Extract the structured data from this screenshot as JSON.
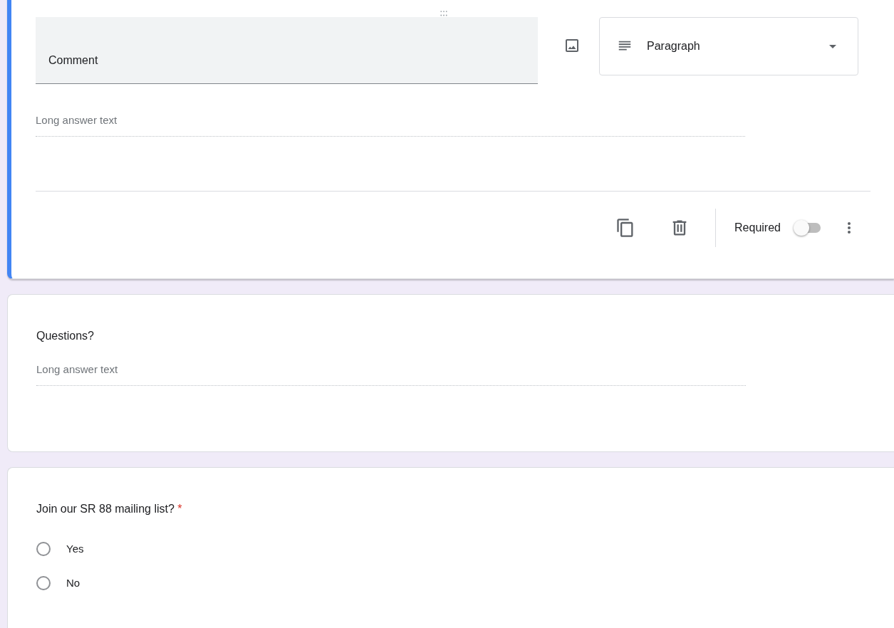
{
  "cards": [
    {
      "kind": "editor",
      "title": "Comment",
      "question_type": "Paragraph",
      "answer_placeholder": "Long answer text",
      "required_label": "Required",
      "required": false
    },
    {
      "kind": "paragraph",
      "title": "Questions?",
      "answer_placeholder": "Long answer text"
    },
    {
      "kind": "choice",
      "title": "Join our SR 88 mailing list?",
      "required": true,
      "required_mark": "*",
      "options": [
        {
          "label": "Yes",
          "selected": false
        },
        {
          "label": "No",
          "selected": false
        }
      ]
    }
  ]
}
